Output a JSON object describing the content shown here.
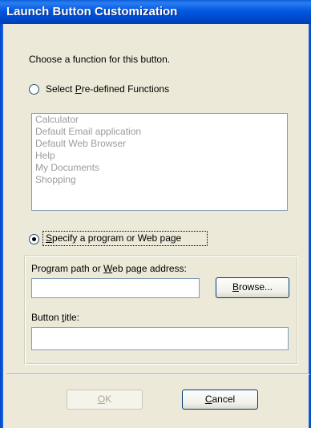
{
  "window": {
    "title": "Launch Button Customization"
  },
  "prompt": "Choose a function for this button.",
  "predefined": {
    "radio_prefix": "Select ",
    "radio_accel": "P",
    "radio_suffix": "re-defined Functions",
    "selected": false,
    "items": [
      "Calculator",
      "Default Email application",
      "Default Web Browser",
      "Help",
      "My Documents",
      "Shopping"
    ]
  },
  "custom": {
    "radio_accel": "S",
    "radio_suffix": "pecify a program or Web page",
    "selected": true,
    "path_label_prefix": "Program path or ",
    "path_label_accel": "W",
    "path_label_suffix": "eb page address:",
    "path_value": "",
    "browse_accel": "B",
    "browse_suffix": "rowse...",
    "title_label_prefix": "Button ",
    "title_label_accel": "t",
    "title_label_suffix": "itle:",
    "title_value": ""
  },
  "buttons": {
    "ok_accel": "O",
    "ok_suffix": "K",
    "ok_enabled": false,
    "cancel_accel": "C",
    "cancel_suffix": "ancel"
  }
}
